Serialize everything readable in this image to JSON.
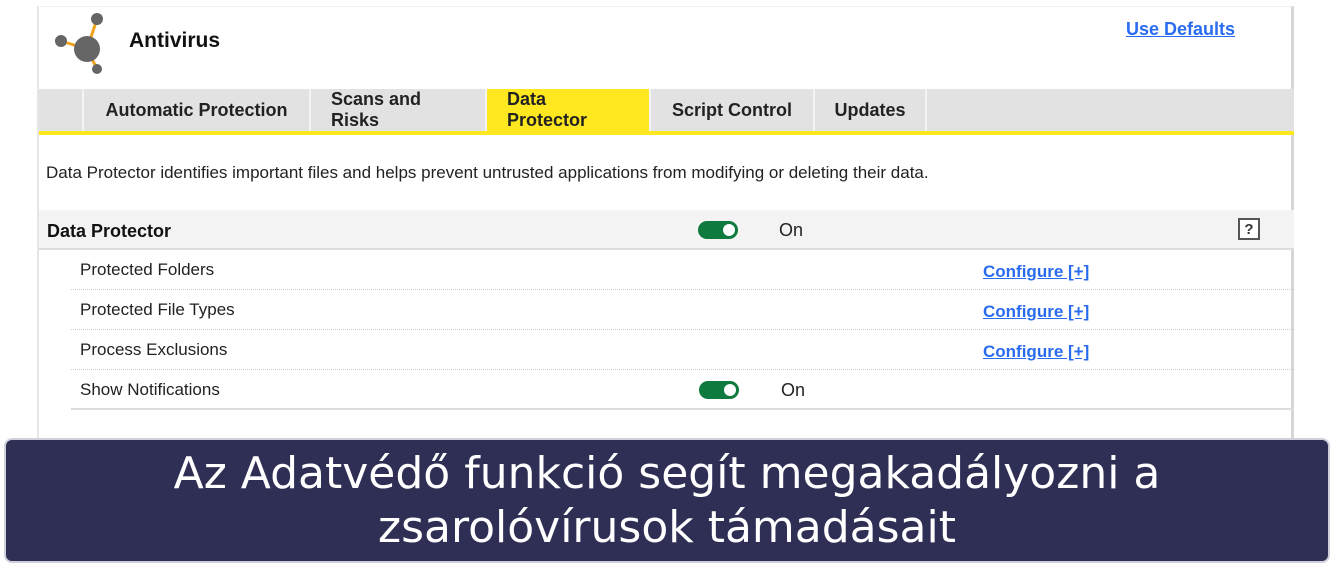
{
  "header": {
    "app_title": "Antivirus",
    "logo_icon": "molecule-icon",
    "use_defaults_label": "Use Defaults"
  },
  "tabs": [
    {
      "label": "Automatic Protection",
      "active": false
    },
    {
      "label": "Scans and Risks",
      "active": false
    },
    {
      "label": "Data Protector",
      "active": true
    },
    {
      "label": "Script Control",
      "active": false
    },
    {
      "label": "Updates",
      "active": false
    }
  ],
  "main": {
    "description": "Data Protector identifies important files and helps prevent untrusted applications from modifying or deleting their data.",
    "section": {
      "title": "Data Protector",
      "toggle_state": "On",
      "help_label": "?"
    },
    "rows": [
      {
        "label": "Protected Folders",
        "action": "Configure [+]"
      },
      {
        "label": "Protected File Types",
        "action": "Configure [+]"
      },
      {
        "label": "Process Exclusions",
        "action": "Configure [+]"
      },
      {
        "label": "Show Notifications",
        "toggle_state": "On"
      }
    ]
  },
  "caption": {
    "line1": "Az Adatvédő funkció segít megakadályozni a",
    "line2": "zsarolóvírusok támadásait"
  },
  "colors": {
    "accent_yellow": "#ffe81f",
    "link_blue": "#2a6cf0",
    "toggle_green": "#0e7a3e",
    "caption_bg": "#2f2f55",
    "logo_orange": "#f2a31b",
    "logo_gray": "#666666"
  }
}
